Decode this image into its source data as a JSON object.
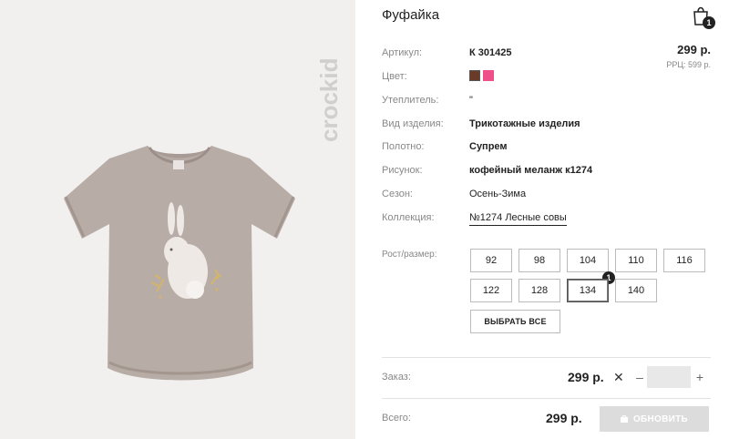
{
  "product": {
    "title": "Фуфайка",
    "image_brand": "crockid"
  },
  "cart": {
    "count": "1",
    "icon": "shopping-bag-icon"
  },
  "price": {
    "main": "299 р.",
    "rrp": "РРЦ: 599 р."
  },
  "attributes": {
    "article": {
      "label": "Артикул:",
      "value": "К 301425"
    },
    "color": {
      "label": "Цвет:",
      "swatches": [
        "#6b3b2a",
        "#f0508a"
      ]
    },
    "insulation": {
      "label": "Утеплитель:",
      "value": "\""
    },
    "type": {
      "label": "Вид изделия:",
      "value": "Трикотажные изделия"
    },
    "fabric": {
      "label": "Полотно:",
      "value": "Супрем"
    },
    "pattern": {
      "label": "Рисунок:",
      "value": "кофейный меланж к1274"
    },
    "season": {
      "label": "Сезон:",
      "value": "Осень-Зима"
    },
    "collection": {
      "label": "Коллекция:",
      "value": "№1274 Лесные совы"
    }
  },
  "sizes": {
    "label": "Рост/размер:",
    "items": [
      "92",
      "98",
      "104",
      "110",
      "116",
      "122",
      "128",
      "134",
      "140"
    ],
    "selected": "134",
    "badges": {
      "104": "1"
    },
    "select_all": "ВЫБРАТЬ ВСЕ"
  },
  "order": {
    "label": "Заказ:",
    "price": "299 р.",
    "quantity_value": "",
    "minus": "–",
    "plus": "+",
    "times": "✕"
  },
  "total": {
    "label": "Всего:",
    "price": "299 р.",
    "update_label": "ОБНОВИТЬ"
  },
  "colors": {
    "accent": "#222222",
    "muted_label": "#888888",
    "image_bg": "#f1f0ef",
    "tshirt": "#b3a6a0"
  }
}
